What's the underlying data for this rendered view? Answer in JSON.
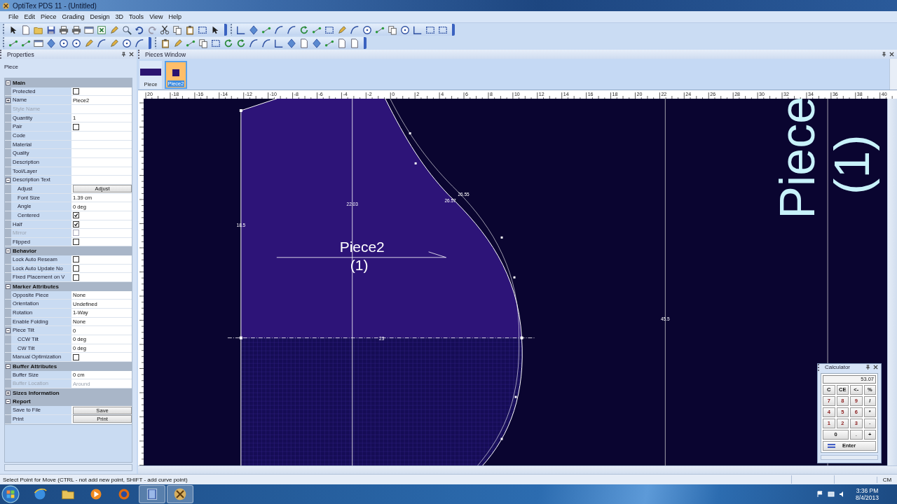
{
  "window": {
    "title": "OptiTex PDS 11 - (Untitled)"
  },
  "menu": [
    "File",
    "Edit",
    "Piece",
    "Grading",
    "Design",
    "3D",
    "Tools",
    "View",
    "Help"
  ],
  "properties": {
    "title": "Properties",
    "object": "Piece",
    "sections": [
      {
        "title": "Main",
        "expanded": true,
        "rows": [
          {
            "label": "Protected",
            "kind": "checkbox",
            "checked": false,
            "disabled": false
          },
          {
            "label": "Name",
            "kind": "text",
            "value": "Piece2",
            "disabled": false,
            "expanded": false
          },
          {
            "label": "Style Name",
            "kind": "text",
            "disabled": true
          },
          {
            "label": "Quantity",
            "kind": "text",
            "value": "1",
            "disabled": false
          },
          {
            "label": "Pair",
            "kind": "checkbox",
            "checked": false,
            "disabled": false
          },
          {
            "label": "Code",
            "kind": "text",
            "disabled": false
          },
          {
            "label": "Material",
            "kind": "text",
            "disabled": false
          },
          {
            "label": "Quality",
            "kind": "text",
            "disabled": false
          },
          {
            "label": "Description",
            "kind": "text",
            "disabled": false
          },
          {
            "label": "Tool/Layer",
            "kind": "text",
            "disabled": false
          },
          {
            "label": "Description Text",
            "kind": "text",
            "disabled": false,
            "expanded": true,
            "children": [
              {
                "label": "Adjust",
                "kind": "button",
                "value": "Adjust",
                "disabled": false
              },
              {
                "label": "Font Size",
                "kind": "text",
                "value": "1.39 cm",
                "disabled": false
              },
              {
                "label": "Angle",
                "kind": "text",
                "value": "0 deg",
                "disabled": false
              },
              {
                "label": "Centered",
                "kind": "checkbox",
                "checked": true,
                "disabled": false
              }
            ]
          },
          {
            "label": "Half",
            "kind": "checkbox",
            "checked": true,
            "disabled": false
          },
          {
            "label": "Mirror",
            "kind": "checkbox",
            "checked": false,
            "disabled": true
          },
          {
            "label": "Flipped",
            "kind": "checkbox",
            "checked": false,
            "disabled": false
          }
        ]
      },
      {
        "title": "Behavior",
        "expanded": true,
        "rows": [
          {
            "label": "Lock Auto Reseam",
            "kind": "checkbox",
            "checked": false,
            "disabled": false
          },
          {
            "label": "Lock Auto Update No",
            "kind": "checkbox",
            "checked": false,
            "disabled": false
          },
          {
            "label": "Fixed Placement on V",
            "kind": "checkbox",
            "checked": false,
            "disabled": false
          }
        ]
      },
      {
        "title": "Marker Attributes",
        "expanded": true,
        "rows": [
          {
            "label": "Opposite Piece",
            "kind": "text",
            "value": "None",
            "disabled": false
          },
          {
            "label": "Orientation",
            "kind": "text",
            "value": "Undefined",
            "disabled": false
          },
          {
            "label": "Rotation",
            "kind": "text",
            "value": "1-Way",
            "disabled": false
          },
          {
            "label": "Enable Folding",
            "kind": "text",
            "value": "None",
            "disabled": false
          },
          {
            "label": "Piece Tilt",
            "kind": "text",
            "value": "0",
            "disabled": false,
            "expanded": true,
            "children": [
              {
                "label": "CCW Tilt",
                "kind": "text",
                "value": "0 deg",
                "disabled": false
              },
              {
                "label": "CW Tilt",
                "kind": "text",
                "value": "0 deg",
                "disabled": false
              }
            ]
          },
          {
            "label": "Manual Optimization",
            "kind": "checkbox",
            "checked": false,
            "disabled": false
          }
        ]
      },
      {
        "title": "Buffer Attributes",
        "expanded": true,
        "rows": [
          {
            "label": "Buffer Size",
            "kind": "text",
            "value": "0 cm",
            "disabled": false
          },
          {
            "label": "Buffer Location",
            "kind": "text",
            "value": "Around",
            "disabled": true
          }
        ]
      },
      {
        "title": "Sizes Information",
        "expanded": false
      },
      {
        "title": "Report",
        "expanded": true,
        "rows": [
          {
            "label": "Save to File",
            "kind": "button",
            "value": "Save",
            "disabled": false
          },
          {
            "label": "Print",
            "kind": "button",
            "value": "Print",
            "disabled": false
          }
        ]
      }
    ]
  },
  "pieces_window": {
    "title": "Pieces Window",
    "pieces": [
      {
        "label": "Piece",
        "selected": false
      },
      {
        "label": "Piece2",
        "selected": true
      }
    ]
  },
  "ruler": {
    "labels": [
      "20",
      "-18",
      "-16",
      "-14",
      "-12",
      "-10",
      "-8",
      "-6",
      "-4",
      "-2",
      "0",
      "2",
      "4",
      "6",
      "8",
      "10",
      "12",
      "14",
      "16",
      "18",
      "20",
      "22",
      "24",
      "26",
      "28",
      "30",
      "32",
      "34",
      "36",
      "38",
      "40"
    ]
  },
  "canvas": {
    "piece_name": "Piece2",
    "piece_quantity": "(1)",
    "measurements": [
      "22.03",
      "18.5",
      "26.57",
      "26.55",
      "23",
      "45.5"
    ],
    "rotated_label": [
      "Piece",
      "(1)"
    ]
  },
  "calculator": {
    "title": "Calculator",
    "display": "53.07",
    "keys": [
      {
        "label": "C",
        "kind": "op"
      },
      {
        "label": "CE",
        "kind": "op"
      },
      {
        "label": "<-",
        "kind": "op"
      },
      {
        "label": "%",
        "kind": "op"
      },
      {
        "label": "7",
        "kind": "digit"
      },
      {
        "label": "8",
        "kind": "digit"
      },
      {
        "label": "9",
        "kind": "digit"
      },
      {
        "label": "/",
        "kind": "op"
      },
      {
        "label": "4",
        "kind": "digit"
      },
      {
        "label": "5",
        "kind": "digit"
      },
      {
        "label": "6",
        "kind": "digit"
      },
      {
        "label": "*",
        "kind": "op"
      },
      {
        "label": "1",
        "kind": "digit"
      },
      {
        "label": "2",
        "kind": "digit"
      },
      {
        "label": "3",
        "kind": "digit"
      },
      {
        "label": "-",
        "kind": "faint"
      },
      {
        "label": "0",
        "kind": "wide"
      },
      {
        "label": ".",
        "kind": "faint"
      },
      {
        "label": "+",
        "kind": "op"
      },
      {
        "label": "Enter",
        "kind": "enter"
      }
    ]
  },
  "status_bar": {
    "message": "Select Point for Move (CTRL - not add new point, SHIFT - add curve point)",
    "units": "CM"
  },
  "taskbar": {
    "apps": [
      {
        "kind": "browser",
        "active": false
      },
      {
        "kind": "folder",
        "active": false
      },
      {
        "kind": "player",
        "active": false
      },
      {
        "kind": "firefox",
        "active": false
      },
      {
        "kind": "film",
        "active": true
      },
      {
        "kind": "optitex",
        "active": true
      }
    ],
    "time": "3:36 PM",
    "date": "8/4/2013"
  }
}
